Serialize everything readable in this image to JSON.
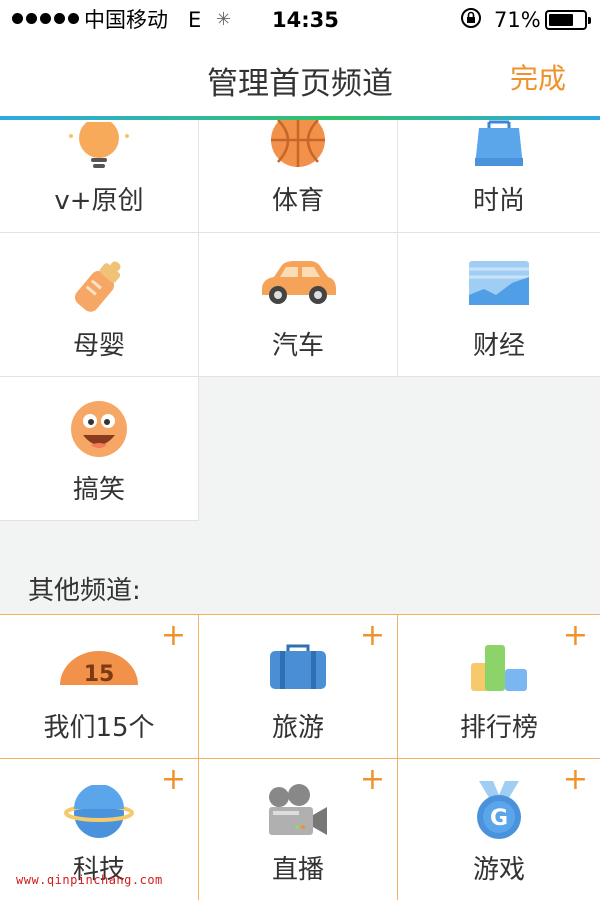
{
  "status_bar": {
    "carrier": "中国移动",
    "network": "E",
    "time": "14:35",
    "battery": "71%",
    "battery_level": 0.71
  },
  "nav": {
    "title": "管理首页频道",
    "done_label": "完成"
  },
  "my_channels": [
    {
      "label": "v+原创",
      "icon": "lightbulb-icon"
    },
    {
      "label": "体育",
      "icon": "basketball-icon"
    },
    {
      "label": "时尚",
      "icon": "shopping-bag-icon"
    },
    {
      "label": "母婴",
      "icon": "baby-bottle-icon"
    },
    {
      "label": "汽车",
      "icon": "car-icon"
    },
    {
      "label": "财经",
      "icon": "finance-chart-icon"
    },
    {
      "label": "搞笑",
      "icon": "funny-face-icon"
    }
  ],
  "other_section_label": "其他频道:",
  "other_channels": [
    {
      "label": "我们15个",
      "icon": "badge-15-icon",
      "badge_text": "15"
    },
    {
      "label": "旅游",
      "icon": "suitcase-icon"
    },
    {
      "label": "排行榜",
      "icon": "ranking-bars-icon"
    },
    {
      "label": "科技",
      "icon": "planet-icon"
    },
    {
      "label": "直播",
      "icon": "video-camera-icon"
    },
    {
      "label": "游戏",
      "icon": "medal-g-icon",
      "badge_text": "G"
    }
  ],
  "add_symbol": "+",
  "watermark": "www.qinpinchang.com",
  "colors": {
    "accent": "#f0922c",
    "divider_other": "#f2b064",
    "page_bg": "#f2f3f3"
  }
}
